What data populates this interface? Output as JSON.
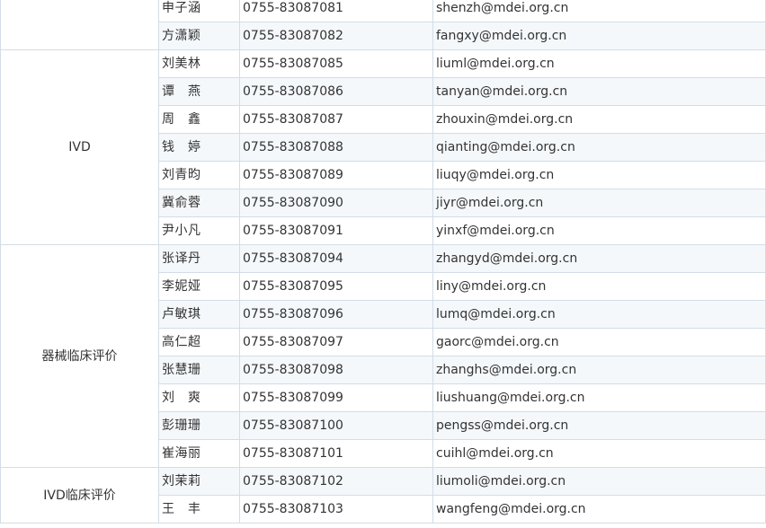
{
  "groups": [
    {
      "department": "",
      "contacts": [
        {
          "name": "申子涵",
          "phone": "0755-83087081",
          "email": "shenzh@mdei.org.cn"
        },
        {
          "name": "方潇颖",
          "phone": "0755-83087082",
          "email": "fangxy@mdei.org.cn"
        }
      ]
    },
    {
      "department": "IVD",
      "contacts": [
        {
          "name": "刘美林",
          "phone": "0755-83087085",
          "email": "liuml@mdei.org.cn"
        },
        {
          "name": "谭　燕",
          "phone": "0755-83087086",
          "email": "tanyan@mdei.org.cn"
        },
        {
          "name": "周　鑫",
          "phone": "0755-83087087",
          "email": "zhouxin@mdei.org.cn"
        },
        {
          "name": "钱　婷",
          "phone": "0755-83087088",
          "email": "qianting@mdei.org.cn"
        },
        {
          "name": "刘青昀",
          "phone": "0755-83087089",
          "email": "liuqy@mdei.org.cn"
        },
        {
          "name": "冀俞蓉",
          "phone": "0755-83087090",
          "email": "jiyr@mdei.org.cn"
        },
        {
          "name": "尹小凡",
          "phone": "0755-83087091",
          "email": "yinxf@mdei.org.cn"
        }
      ]
    },
    {
      "department": "器械临床评价",
      "contacts": [
        {
          "name": "张译丹",
          "phone": "0755-83087094",
          "email": "zhangyd@mdei.org.cn"
        },
        {
          "name": "李妮娅",
          "phone": "0755-83087095",
          "email": "liny@mdei.org.cn"
        },
        {
          "name": "卢敏琪",
          "phone": "0755-83087096",
          "email": "lumq@mdei.org.cn"
        },
        {
          "name": "高仁超",
          "phone": "0755-83087097",
          "email": "gaorc@mdei.org.cn"
        },
        {
          "name": "张慧珊",
          "phone": "0755-83087098",
          "email": "zhanghs@mdei.org.cn"
        },
        {
          "name": "刘　爽",
          "phone": "0755-83087099",
          "email": "liushuang@mdei.org.cn"
        },
        {
          "name": "彭珊珊",
          "phone": "0755-83087100",
          "email": "pengss@mdei.org.cn"
        },
        {
          "name": "崔海丽",
          "phone": "0755-83087101",
          "email": "cuihl@mdei.org.cn"
        }
      ]
    },
    {
      "department": "IVD临床评价",
      "contacts": [
        {
          "name": "刘茉莉",
          "phone": "0755-83087102",
          "email": "liumoli@mdei.org.cn"
        },
        {
          "name": "王　丰",
          "phone": "0755-83087103",
          "email": "wangfeng@mdei.org.cn"
        }
      ]
    }
  ],
  "colors": {
    "border": "#d3dde6",
    "alt_row": "#f5f8fb",
    "text": "#333333"
  }
}
